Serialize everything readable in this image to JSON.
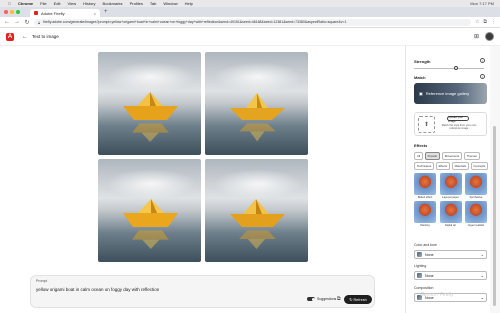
{
  "mac_menu": {
    "app": "Chrome",
    "items": [
      "File",
      "Edit",
      "View",
      "History",
      "Bookmarks",
      "Profiles",
      "Tab",
      "Window",
      "Help"
    ],
    "right": "Mon 7:17 PM"
  },
  "browser": {
    "tab_title": "Adobe Firefly",
    "url": "firefly.adobe.com/generate/images?prompt=yellow+origami+boat+in+calm+ocean+on+foggy+day+with+reflection&seed=49151&seed=46168&seed=12381&seed=73380&aspectRatio=square&v=1",
    "colors": {
      "red": "#ff5f57",
      "yellow": "#febc2e",
      "green": "#28c840"
    }
  },
  "appbar": {
    "logo": "A",
    "crumb": "Text to image"
  },
  "images": [
    {
      "alt": "boat-1"
    },
    {
      "alt": "boat-2"
    },
    {
      "alt": "boat-3"
    },
    {
      "alt": "boat-4"
    }
  ],
  "prompt": {
    "label": "Prompt",
    "text": "yellow origami boat in calm ocean on foggy day with reflection",
    "suggestions": "Suggestions",
    "refresh": "Refresh"
  },
  "panel": {
    "strength": "Strength",
    "match": "Match",
    "ref_gallery": "Reference image gallery",
    "upload_btn": "Upload your image",
    "upload_hint": "Match the style from your own reference image",
    "effects": "Effects",
    "chips": [
      {
        "label": "All",
        "sel": false
      },
      {
        "label": "Popular",
        "sel": true
      },
      {
        "label": "Movements",
        "sel": false
      },
      {
        "label": "Themes",
        "sel": false
      },
      {
        "label": "Techniques",
        "sel": false
      },
      {
        "label": "Effects",
        "sel": false
      },
      {
        "label": "Materials",
        "sel": false
      },
      {
        "label": "Concepts",
        "sel": false
      }
    ],
    "effect_items": [
      "Bokeh effect",
      "Layered paper",
      "Synthwave",
      "Painting",
      "Digital art",
      "Hyper realistic"
    ],
    "color_tone": "Color and tone",
    "lighting": "Lighting",
    "composition": "Composition",
    "none": "None"
  },
  "watermark": "Gemini / Firefly"
}
